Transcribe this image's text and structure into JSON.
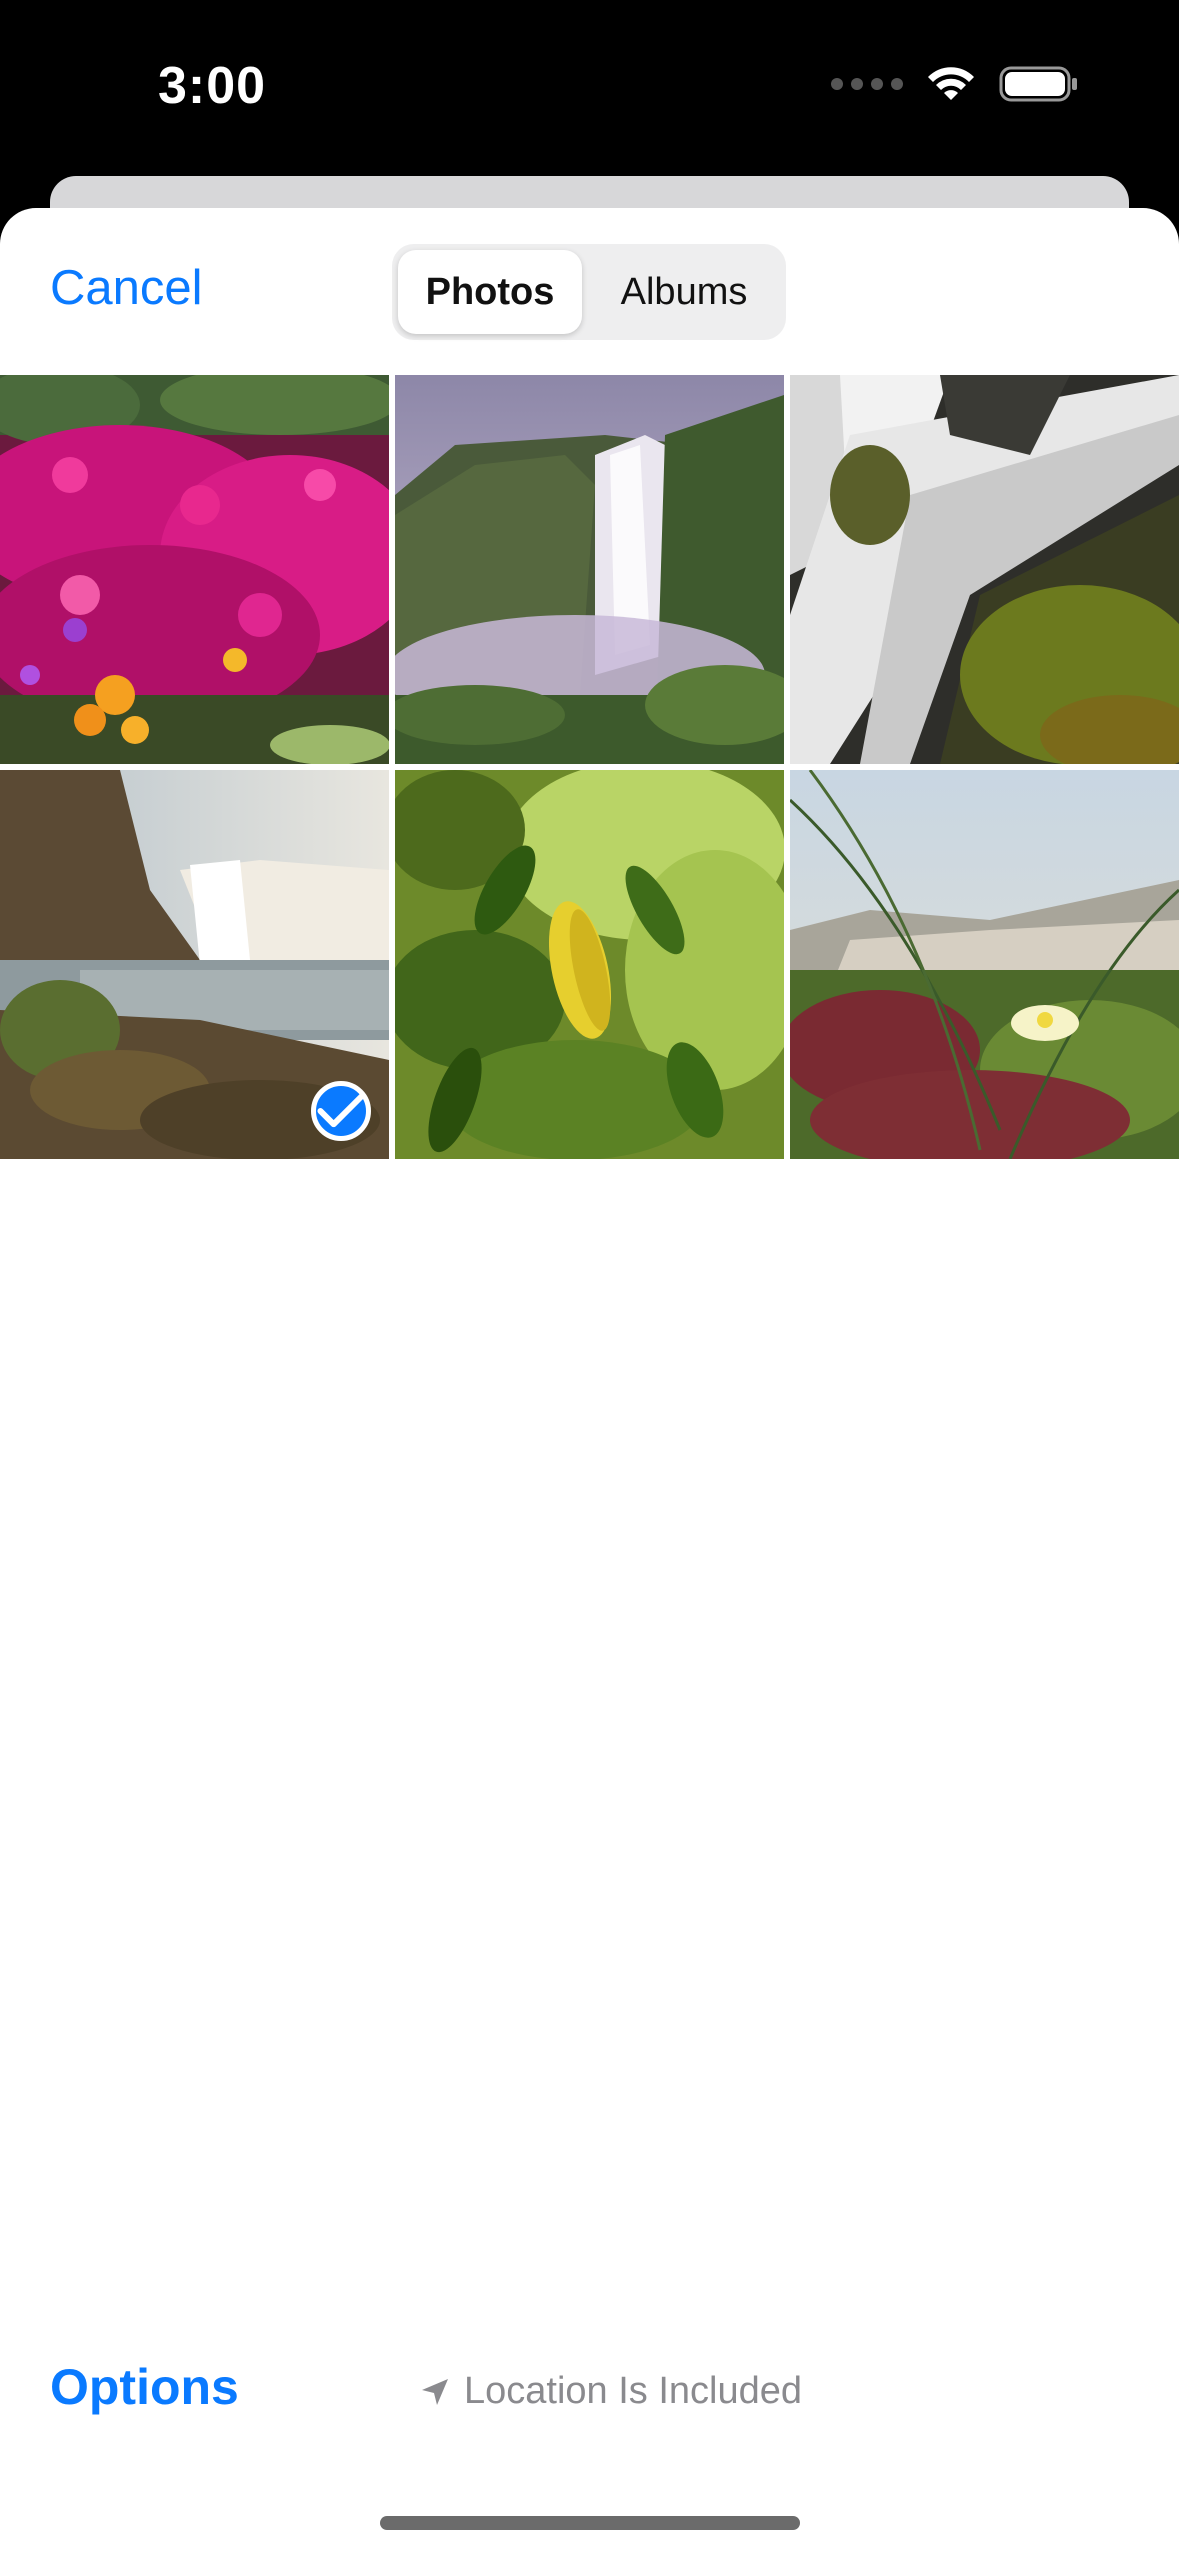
{
  "status_bar": {
    "time": "3:00"
  },
  "nav": {
    "cancel_label": "Cancel",
    "segments": [
      {
        "label": "Photos",
        "selected": true
      },
      {
        "label": "Albums",
        "selected": false
      }
    ]
  },
  "grid": {
    "photos": [
      {
        "subject": "pink-flowers",
        "selected": false
      },
      {
        "subject": "waterfall-cliff",
        "selected": false
      },
      {
        "subject": "waterfall-rocks",
        "selected": false
      },
      {
        "subject": "waterfall-coast",
        "selected": true
      },
      {
        "subject": "green-leaves",
        "selected": false
      },
      {
        "subject": "dune-grass-flower",
        "selected": false
      }
    ]
  },
  "toolbar": {
    "options_label": "Options",
    "location_label": "Location Is Included",
    "location_icon": "location-arrow-icon"
  },
  "colors": {
    "accent": "#0a7aff",
    "secondary_text": "#8a8a8e"
  }
}
